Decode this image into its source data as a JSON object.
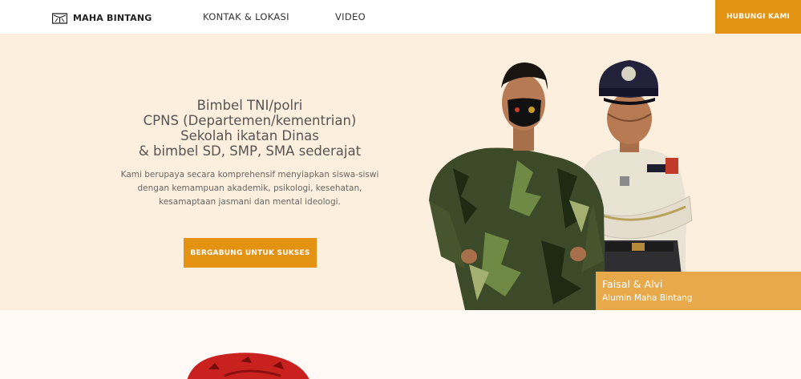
{
  "nav": {
    "logo_text": "MAHA BINTANG",
    "links": [
      "KONTAK & LOKASI",
      "VIDEO"
    ],
    "cta": "HUBUNGI KAMI"
  },
  "hero": {
    "title_lines": [
      "Bimbel TNI/polri",
      "CPNS (Departemen/kementrian)",
      "Sekolah ikatan Dinas",
      "& bimbel SD, SMP, SMA sederajat"
    ],
    "description_lines": [
      "Kami berupaya secara komprehensif menyiapkan siswa-siswi",
      "dengan kemampuan akademik, psikologi, kesehatan,",
      "kesamaptaan jasmani dan mental ideologi."
    ],
    "cta": "BERGABUNG UNTUK SUKSES",
    "caption": {
      "name": "Faisal & Alvi",
      "subtitle": "Alumin Maha Bintang"
    }
  },
  "colors": {
    "accent": "#e39212",
    "hero_bg": "#fdefdd",
    "caption_bg": "#e8a94a"
  }
}
